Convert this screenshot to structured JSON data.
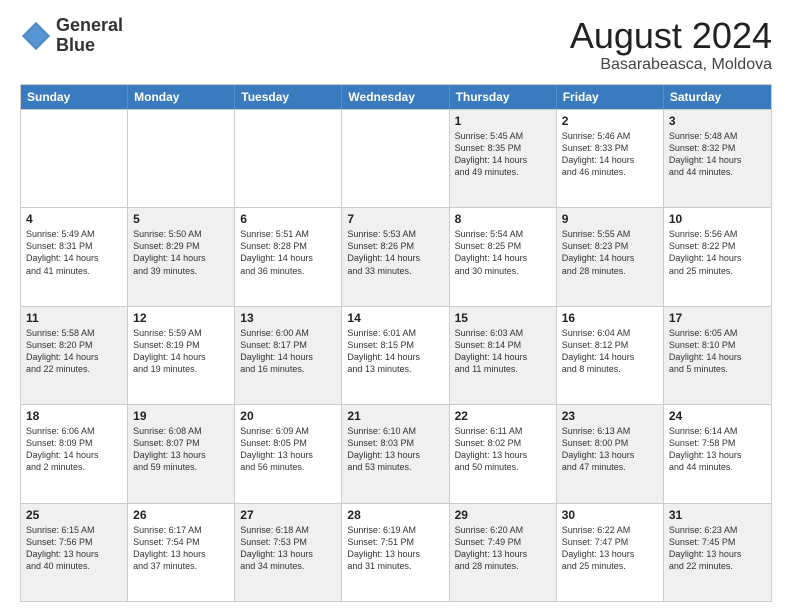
{
  "logo": {
    "line1": "General",
    "line2": "Blue"
  },
  "title": "August 2024",
  "location": "Basarabeasca, Moldova",
  "header_days": [
    "Sunday",
    "Monday",
    "Tuesday",
    "Wednesday",
    "Thursday",
    "Friday",
    "Saturday"
  ],
  "rows": [
    [
      {
        "day": "",
        "info": "",
        "shaded": false,
        "empty": true
      },
      {
        "day": "",
        "info": "",
        "shaded": false,
        "empty": true
      },
      {
        "day": "",
        "info": "",
        "shaded": false,
        "empty": true
      },
      {
        "day": "",
        "info": "",
        "shaded": false,
        "empty": true
      },
      {
        "day": "1",
        "info": "Sunrise: 5:45 AM\nSunset: 8:35 PM\nDaylight: 14 hours\nand 49 minutes.",
        "shaded": true
      },
      {
        "day": "2",
        "info": "Sunrise: 5:46 AM\nSunset: 8:33 PM\nDaylight: 14 hours\nand 46 minutes.",
        "shaded": false
      },
      {
        "day": "3",
        "info": "Sunrise: 5:48 AM\nSunset: 8:32 PM\nDaylight: 14 hours\nand 44 minutes.",
        "shaded": true
      }
    ],
    [
      {
        "day": "4",
        "info": "Sunrise: 5:49 AM\nSunset: 8:31 PM\nDaylight: 14 hours\nand 41 minutes.",
        "shaded": false
      },
      {
        "day": "5",
        "info": "Sunrise: 5:50 AM\nSunset: 8:29 PM\nDaylight: 14 hours\nand 39 minutes.",
        "shaded": true
      },
      {
        "day": "6",
        "info": "Sunrise: 5:51 AM\nSunset: 8:28 PM\nDaylight: 14 hours\nand 36 minutes.",
        "shaded": false
      },
      {
        "day": "7",
        "info": "Sunrise: 5:53 AM\nSunset: 8:26 PM\nDaylight: 14 hours\nand 33 minutes.",
        "shaded": true
      },
      {
        "day": "8",
        "info": "Sunrise: 5:54 AM\nSunset: 8:25 PM\nDaylight: 14 hours\nand 30 minutes.",
        "shaded": false
      },
      {
        "day": "9",
        "info": "Sunrise: 5:55 AM\nSunset: 8:23 PM\nDaylight: 14 hours\nand 28 minutes.",
        "shaded": true
      },
      {
        "day": "10",
        "info": "Sunrise: 5:56 AM\nSunset: 8:22 PM\nDaylight: 14 hours\nand 25 minutes.",
        "shaded": false
      }
    ],
    [
      {
        "day": "11",
        "info": "Sunrise: 5:58 AM\nSunset: 8:20 PM\nDaylight: 14 hours\nand 22 minutes.",
        "shaded": true
      },
      {
        "day": "12",
        "info": "Sunrise: 5:59 AM\nSunset: 8:19 PM\nDaylight: 14 hours\nand 19 minutes.",
        "shaded": false
      },
      {
        "day": "13",
        "info": "Sunrise: 6:00 AM\nSunset: 8:17 PM\nDaylight: 14 hours\nand 16 minutes.",
        "shaded": true
      },
      {
        "day": "14",
        "info": "Sunrise: 6:01 AM\nSunset: 8:15 PM\nDaylight: 14 hours\nand 13 minutes.",
        "shaded": false
      },
      {
        "day": "15",
        "info": "Sunrise: 6:03 AM\nSunset: 8:14 PM\nDaylight: 14 hours\nand 11 minutes.",
        "shaded": true
      },
      {
        "day": "16",
        "info": "Sunrise: 6:04 AM\nSunset: 8:12 PM\nDaylight: 14 hours\nand 8 minutes.",
        "shaded": false
      },
      {
        "day": "17",
        "info": "Sunrise: 6:05 AM\nSunset: 8:10 PM\nDaylight: 14 hours\nand 5 minutes.",
        "shaded": true
      }
    ],
    [
      {
        "day": "18",
        "info": "Sunrise: 6:06 AM\nSunset: 8:09 PM\nDaylight: 14 hours\nand 2 minutes.",
        "shaded": false
      },
      {
        "day": "19",
        "info": "Sunrise: 6:08 AM\nSunset: 8:07 PM\nDaylight: 13 hours\nand 59 minutes.",
        "shaded": true
      },
      {
        "day": "20",
        "info": "Sunrise: 6:09 AM\nSunset: 8:05 PM\nDaylight: 13 hours\nand 56 minutes.",
        "shaded": false
      },
      {
        "day": "21",
        "info": "Sunrise: 6:10 AM\nSunset: 8:03 PM\nDaylight: 13 hours\nand 53 minutes.",
        "shaded": true
      },
      {
        "day": "22",
        "info": "Sunrise: 6:11 AM\nSunset: 8:02 PM\nDaylight: 13 hours\nand 50 minutes.",
        "shaded": false
      },
      {
        "day": "23",
        "info": "Sunrise: 6:13 AM\nSunset: 8:00 PM\nDaylight: 13 hours\nand 47 minutes.",
        "shaded": true
      },
      {
        "day": "24",
        "info": "Sunrise: 6:14 AM\nSunset: 7:58 PM\nDaylight: 13 hours\nand 44 minutes.",
        "shaded": false
      }
    ],
    [
      {
        "day": "25",
        "info": "Sunrise: 6:15 AM\nSunset: 7:56 PM\nDaylight: 13 hours\nand 40 minutes.",
        "shaded": true
      },
      {
        "day": "26",
        "info": "Sunrise: 6:17 AM\nSunset: 7:54 PM\nDaylight: 13 hours\nand 37 minutes.",
        "shaded": false
      },
      {
        "day": "27",
        "info": "Sunrise: 6:18 AM\nSunset: 7:53 PM\nDaylight: 13 hours\nand 34 minutes.",
        "shaded": true
      },
      {
        "day": "28",
        "info": "Sunrise: 6:19 AM\nSunset: 7:51 PM\nDaylight: 13 hours\nand 31 minutes.",
        "shaded": false
      },
      {
        "day": "29",
        "info": "Sunrise: 6:20 AM\nSunset: 7:49 PM\nDaylight: 13 hours\nand 28 minutes.",
        "shaded": true
      },
      {
        "day": "30",
        "info": "Sunrise: 6:22 AM\nSunset: 7:47 PM\nDaylight: 13 hours\nand 25 minutes.",
        "shaded": false
      },
      {
        "day": "31",
        "info": "Sunrise: 6:23 AM\nSunset: 7:45 PM\nDaylight: 13 hours\nand 22 minutes.",
        "shaded": true
      }
    ]
  ]
}
